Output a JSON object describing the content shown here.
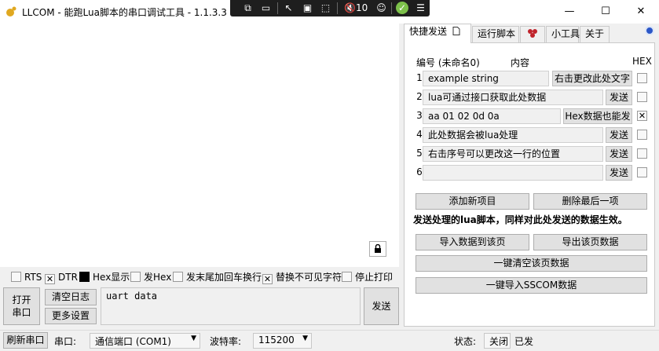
{
  "window": {
    "title": "LLCOM - 能跑Lua脚本的串口调试工具 - 1.1.3.3",
    "minimize_glyph": "—",
    "maximize_glyph": "☐",
    "close_glyph": "✕"
  },
  "recorder_toolbar": {
    "count": "10",
    "icons": [
      "screen-record-icon",
      "camera-icon",
      "pointer-icon",
      "window-select-icon",
      "region-select-icon",
      "speaker-icon",
      "accessibility-icon",
      "check-icon",
      "menu-icon"
    ]
  },
  "log": {
    "lock_glyph": "🔒"
  },
  "options": {
    "rts": "RTS",
    "dtr": "DTR",
    "hex_display": "Hex显示",
    "hex_send": "发Hex",
    "append_crlf": "发末尾加回车换行",
    "replace_invisible": "替换不可见字符",
    "pause_print": "停止打印"
  },
  "controls": {
    "open_port": "打开\n串口",
    "clear_log": "清空日志",
    "more_settings": "更多设置",
    "send_text": "uart data",
    "send_button": "发送"
  },
  "statusbar": {
    "refresh": "刷新串口",
    "port_label": "串口:",
    "port_value": "通信端口 (COM1)",
    "baud_label": "波特率:",
    "baud_value": "115200",
    "status_label": "状态:",
    "status_value": "关闭",
    "sent_label": "已发"
  },
  "panel": {
    "tabs": [
      "快捷发送",
      "运行脚本",
      "",
      "小工具",
      "关于"
    ],
    "header": {
      "number": "编号 (未命名0)",
      "content": "内容",
      "hex": "HEX"
    },
    "rows": [
      {
        "num": "1",
        "text": "example string",
        "button": "右击更改此处文字",
        "hex": false
      },
      {
        "num": "2",
        "text": "lua可通过接口获取此处数据",
        "button": "发送",
        "hex": false
      },
      {
        "num": "3",
        "text": "aa 01 02 0d 0a",
        "button": "Hex数据也能发",
        "hex": true
      },
      {
        "num": "4",
        "text": "此处数据会被lua处理",
        "button": "发送",
        "hex": false
      },
      {
        "num": "5",
        "text": "右击序号可以更改这一行的位置",
        "button": "发送",
        "hex": false
      },
      {
        "num": "6",
        "text": "",
        "button": "发送",
        "hex": false
      }
    ],
    "add_item": "添加新项目",
    "delete_last": "删除最后一项",
    "note": "发送处理的lua脚本，同样对此处发送的数据生效。",
    "import_page": "导入数据到该页",
    "export_page": "导出该页数据",
    "clear_page": "一键清空该页数据",
    "import_sscom": "一键导入SSCOM数据"
  },
  "colors": {
    "accent_blue": "#2b57c7",
    "button_face": "#e1e1e1",
    "window_bg": "#f0f0f0"
  }
}
